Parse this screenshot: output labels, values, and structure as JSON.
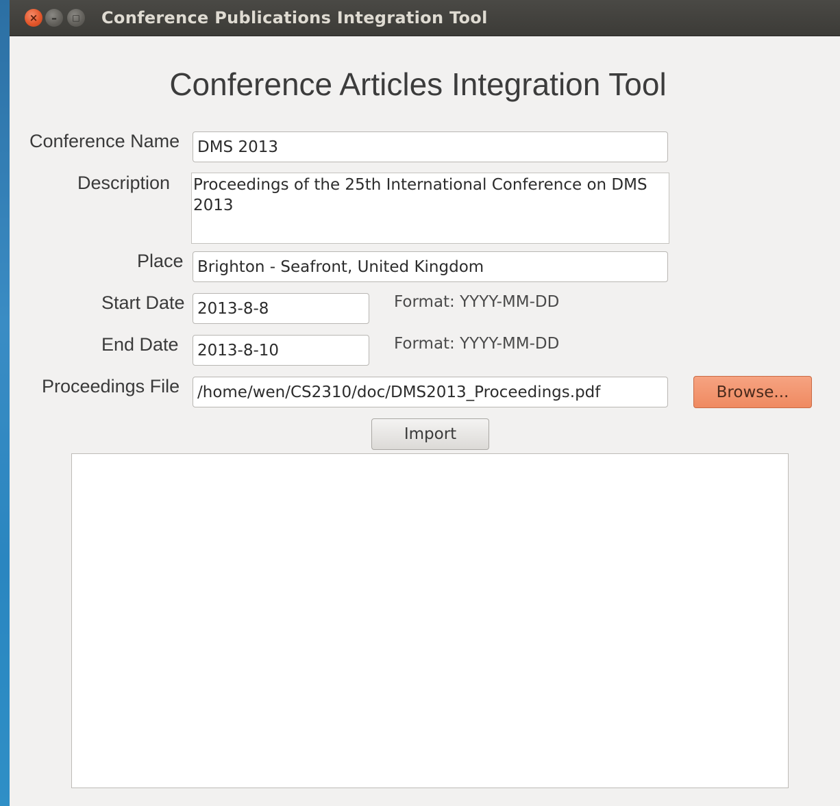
{
  "window": {
    "title": "Conference Publications Integration Tool",
    "close_glyph": "×",
    "minimize_glyph": "–",
    "maximize_glyph": "□"
  },
  "form": {
    "heading": "Conference Articles Integration Tool",
    "conference_name": {
      "label": "Conference Name",
      "value": "DMS 2013"
    },
    "description": {
      "label": "Description",
      "value": "Proceedings of the 25th International Conference on DMS 2013"
    },
    "place": {
      "label": "Place",
      "value": "Brighton - Seafront, United Kingdom"
    },
    "start_date": {
      "label": "Start Date",
      "value": "2013-8-8",
      "hint": "Format: YYYY-MM-DD"
    },
    "end_date": {
      "label": "End Date",
      "value": "2013-8-10",
      "hint": "Format: YYYY-MM-DD"
    },
    "proceedings_file": {
      "label": "Proceedings File",
      "value": "/home/wen/CS2310/doc/DMS2013_Proceedings.pdf"
    },
    "browse_label": "Browse...",
    "import_label": "Import",
    "output_text": ""
  },
  "colors": {
    "browse_accent": "#ef8a61",
    "titlebar": "#3c3b37",
    "close_button": "#e4572b"
  }
}
